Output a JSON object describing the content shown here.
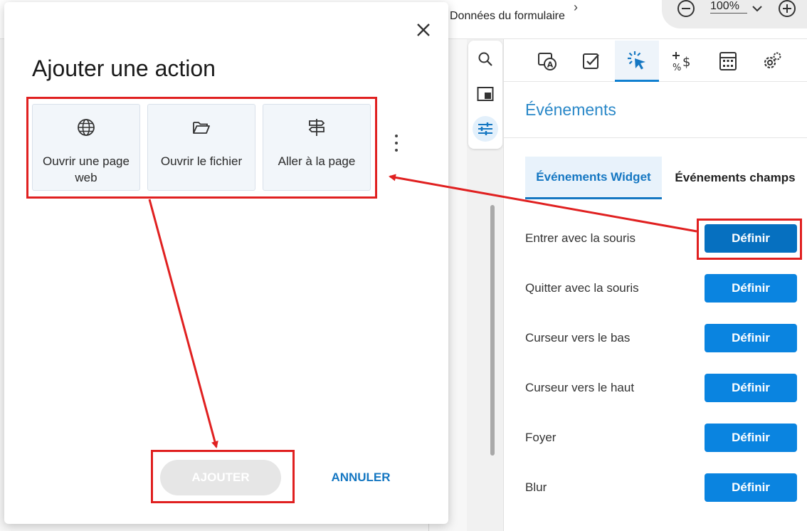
{
  "topbar": {
    "breadcrumb": "Données du formulaire",
    "zoom_value": "100%"
  },
  "icons": {
    "zoom_out": "minus-circle-icon",
    "zoom_in": "plus-circle-icon",
    "search": "search-icon",
    "layout": "layout-icon",
    "sliders": "sliders-icon"
  },
  "dialog": {
    "title": "Ajouter une action",
    "actions": [
      {
        "label": "Ouvrir une page web",
        "icon": "globe-icon"
      },
      {
        "label": "Ouvrir le fichier",
        "icon": "folder-open-icon"
      },
      {
        "label": "Aller à la page",
        "icon": "signpost-icon"
      }
    ],
    "add_label": "AJOUTER",
    "cancel_label": "ANNULER"
  },
  "panel": {
    "tabs": [
      "text-field-icon",
      "checkbox-icon",
      "click-cursor-icon",
      "calculation-icon",
      "calculator-icon",
      "settings-gear-icon"
    ],
    "active_tab": 2,
    "title": "Événements",
    "subtabs": [
      "Événements Widget",
      "Événements champs"
    ],
    "events": [
      {
        "label": "Entrer avec la souris",
        "button": "Définir"
      },
      {
        "label": "Quitter avec la souris",
        "button": "Définir"
      },
      {
        "label": "Curseur vers le bas",
        "button": "Définir"
      },
      {
        "label": "Curseur vers le haut",
        "button": "Définir"
      },
      {
        "label": "Foyer",
        "button": "Définir"
      },
      {
        "label": "Blur",
        "button": "Définir"
      }
    ]
  },
  "colors": {
    "accent": "#1577c2",
    "button": "#0a84e0",
    "annotation": "#e02020"
  }
}
